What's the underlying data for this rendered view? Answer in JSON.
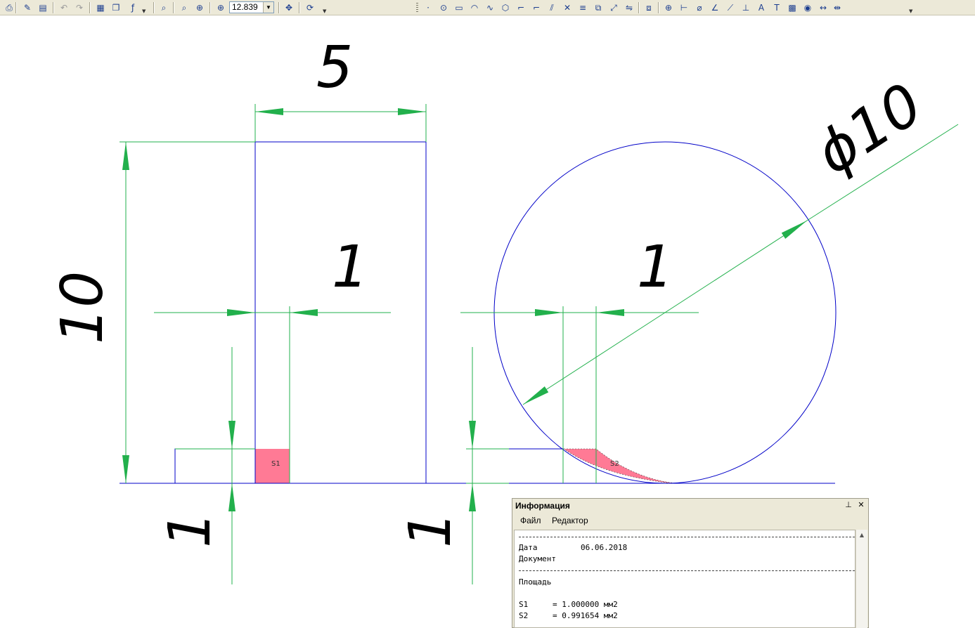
{
  "toolbar": {
    "zoom_value": "12.839",
    "left_group": [
      {
        "name": "print-preview-icon",
        "glyph": "⎙",
        "dim": false
      },
      {
        "name": "brush-icon",
        "glyph": "✎",
        "dim": false
      },
      {
        "name": "properties-icon",
        "glyph": "▤",
        "dim": false
      },
      {
        "name": "undo-icon",
        "glyph": "↶",
        "dim": true
      },
      {
        "name": "redo-icon",
        "glyph": "↷",
        "dim": true
      },
      {
        "name": "calculator-icon",
        "glyph": "▦",
        "dim": false
      },
      {
        "name": "library-icon",
        "glyph": "❐",
        "dim": false
      },
      {
        "name": "formula-icon",
        "glyph": "ƒ",
        "dim": false
      },
      {
        "name": "zoom-window-icon",
        "glyph": "⌕",
        "dim": false
      },
      {
        "name": "zoom-all-icon",
        "glyph": "⌕",
        "dim": false
      },
      {
        "name": "zoom-in-icon",
        "glyph": "⊕",
        "dim": false
      },
      {
        "name": "zoom-scale-icon",
        "glyph": "⊕",
        "dim": false
      },
      {
        "name": "pan-icon",
        "glyph": "✥",
        "dim": false
      },
      {
        "name": "refresh-icon",
        "glyph": "⟳",
        "dim": false
      }
    ],
    "right_group": [
      {
        "name": "point-icon",
        "glyph": "⋅"
      },
      {
        "name": "circle-center-icon",
        "glyph": "⊙"
      },
      {
        "name": "rectangle-icon",
        "glyph": "▭"
      },
      {
        "name": "arc-icon",
        "glyph": "◠"
      },
      {
        "name": "spline-icon",
        "glyph": "∿"
      },
      {
        "name": "polygon-icon",
        "glyph": "⬡"
      },
      {
        "name": "chamfer-icon",
        "glyph": "⌐"
      },
      {
        "name": "fillet-icon",
        "glyph": "⌐"
      },
      {
        "name": "hatch-icon",
        "glyph": "⫽"
      },
      {
        "name": "intersect-icon",
        "glyph": "✕"
      },
      {
        "name": "offset-icon",
        "glyph": "≡"
      },
      {
        "name": "copy-icon",
        "glyph": "⧉"
      },
      {
        "name": "scale-icon",
        "glyph": "⤢"
      },
      {
        "name": "mirror-icon",
        "glyph": "⇋"
      },
      {
        "name": "array-icon",
        "glyph": "⧈"
      },
      {
        "name": "snap-point-icon",
        "glyph": "⊕"
      },
      {
        "name": "linear-dimension-icon",
        "glyph": "⊢"
      },
      {
        "name": "diameter-dimension-icon",
        "glyph": "⌀"
      },
      {
        "name": "angle-dimension-icon",
        "glyph": "∠"
      },
      {
        "name": "leader-icon",
        "glyph": "⟋"
      },
      {
        "name": "datum-icon",
        "glyph": "⊥"
      },
      {
        "name": "text-style-icon",
        "glyph": "A"
      },
      {
        "name": "text-icon",
        "glyph": "T"
      },
      {
        "name": "table-icon",
        "glyph": "▩"
      },
      {
        "name": "measure-icon",
        "glyph": "◉"
      },
      {
        "name": "distance-icon",
        "glyph": "↔"
      },
      {
        "name": "coordinate-icon",
        "glyph": "⇹"
      }
    ]
  },
  "drawing": {
    "colors": {
      "geometry": "#0000c8",
      "dimension": "#22b04c",
      "fill": "#ff7a95",
      "text": "#000000"
    },
    "dims": {
      "top_width": "5",
      "left_height": "10",
      "diameter": "ϕ10",
      "rect_gap": "1",
      "circle_gap": "1",
      "rect_height_small": "1",
      "circle_height_small": "1"
    },
    "labels": {
      "s1": "S1",
      "s2": "S2"
    }
  },
  "info_panel": {
    "title": "Информация",
    "pin_glyph": "⊥",
    "close_glyph": "✕",
    "menu": [
      "Файл",
      "Редактор"
    ],
    "lines": {
      "date_label": "Дата",
      "date_value": "06.06.2018",
      "document_label": "Документ",
      "area_heading": "Площадь",
      "s1_label": "S1",
      "s1_value": "= 1.000000 мм2",
      "s2_label": "S2",
      "s2_value": "= 0.991654 мм2"
    }
  }
}
